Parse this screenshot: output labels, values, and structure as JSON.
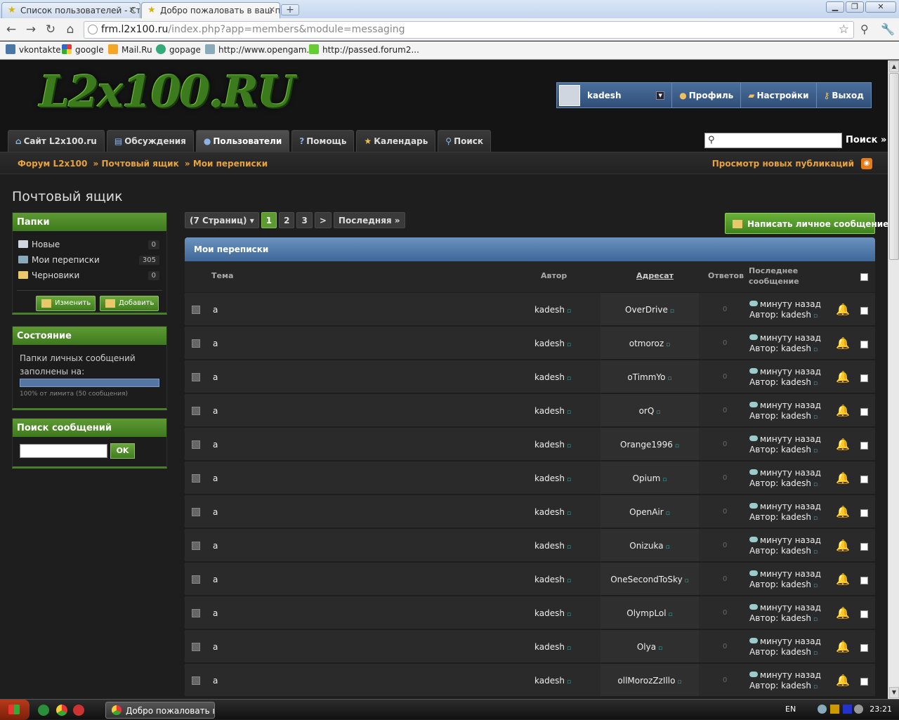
{
  "browser": {
    "tabs": [
      {
        "title": "Список пользователей - Стр"
      },
      {
        "title": "Добро пожаловать в ваш по"
      }
    ],
    "address": {
      "host": "frm.l2x100.ru",
      "path": "/index.php?app=members&module=messaging"
    },
    "bookmarks": [
      "vkontakte",
      "google",
      "Mail.Ru",
      "gopage",
      "http://www.opengam...",
      "http://passed.forum2..."
    ]
  },
  "site": {
    "logo": "L2x100.RU",
    "user": {
      "name": "kadesh",
      "profile": "Профиль",
      "settings": "Настройки",
      "logout": "Выход"
    },
    "nav": [
      "Сайт L2x100.ru",
      "Обсуждения",
      "Пользователи",
      "Помощь",
      "Календарь",
      "Поиск"
    ],
    "search_label": "Поиск »",
    "breadcrumb": [
      "Форум L2x100",
      "» Почтовый ящик",
      "» Мои переписки"
    ],
    "new_posts": "Просмотр новых публикаций"
  },
  "page": {
    "title": "Почтовый ящик",
    "folders": {
      "header": "Папки",
      "items": [
        {
          "label": "Новые",
          "count": "0"
        },
        {
          "label": "Мои переписки",
          "count": "305"
        },
        {
          "label": "Черновики",
          "count": "0"
        }
      ],
      "edit_btn": "Изменить",
      "add_btn": "Добавить"
    },
    "status": {
      "header": "Состояние",
      "text": "Папки личных сообщений заполнены на:",
      "fill_percent": 100,
      "small": "100% от лимита (50 сообщения)"
    },
    "msg_search": {
      "header": "Поиск сообщений",
      "ok": "OK"
    },
    "pager": {
      "pages_label": "(7 Страниц)",
      "pages": [
        "1",
        "2",
        "3"
      ],
      "next": ">",
      "last": "Последняя »"
    },
    "compose": "Написать личное сообщение",
    "table": {
      "title": "Мои переписки",
      "columns": {
        "topic": "Тема",
        "author": "Автор",
        "recipient": "Адресат",
        "replies": "Ответов",
        "last": "Последнее сообщение"
      },
      "rows": [
        {
          "topic": "a",
          "author": "kadesh",
          "recipient": "OverDrive",
          "replies": "0",
          "time": "минуту назад",
          "by": "Автор: kadesh"
        },
        {
          "topic": "a",
          "author": "kadesh",
          "recipient": "otmoroz",
          "replies": "0",
          "time": "минуту назад",
          "by": "Автор: kadesh"
        },
        {
          "topic": "a",
          "author": "kadesh",
          "recipient": "oTimmYo",
          "replies": "0",
          "time": "минуту назад",
          "by": "Автор: kadesh"
        },
        {
          "topic": "a",
          "author": "kadesh",
          "recipient": "orQ",
          "replies": "0",
          "time": "минуту назад",
          "by": "Автор: kadesh"
        },
        {
          "topic": "a",
          "author": "kadesh",
          "recipient": "Orange1996",
          "replies": "0",
          "time": "минуту назад",
          "by": "Автор: kadesh"
        },
        {
          "topic": "a",
          "author": "kadesh",
          "recipient": "Opium",
          "replies": "0",
          "time": "минуту назад",
          "by": "Автор: kadesh"
        },
        {
          "topic": "a",
          "author": "kadesh",
          "recipient": "OpenAir",
          "replies": "0",
          "time": "минуту назад",
          "by": "Автор: kadesh"
        },
        {
          "topic": "a",
          "author": "kadesh",
          "recipient": "Onizuka",
          "replies": "0",
          "time": "минуту назад",
          "by": "Автор: kadesh"
        },
        {
          "topic": "a",
          "author": "kadesh",
          "recipient": "OneSecondToSky",
          "replies": "0",
          "time": "минуту назад",
          "by": "Автор: kadesh"
        },
        {
          "topic": "a",
          "author": "kadesh",
          "recipient": "OlympLol",
          "replies": "0",
          "time": "минуту назад",
          "by": "Автор: kadesh"
        },
        {
          "topic": "a",
          "author": "kadesh",
          "recipient": "Olya",
          "replies": "0",
          "time": "минуту назад",
          "by": "Автор: kadesh"
        },
        {
          "topic": "a",
          "author": "kadesh",
          "recipient": "ollMorozZzIllo",
          "replies": "0",
          "time": "минуту назад",
          "by": "Автор: kadesh"
        }
      ]
    }
  },
  "taskbar": {
    "task": "Добро пожаловать в...",
    "lang": "EN",
    "clock": "23:21"
  },
  "colors": {
    "accent_green": "#5e9a33",
    "header_blue": "#4a6f9c",
    "link_orange": "#e8a23c"
  }
}
